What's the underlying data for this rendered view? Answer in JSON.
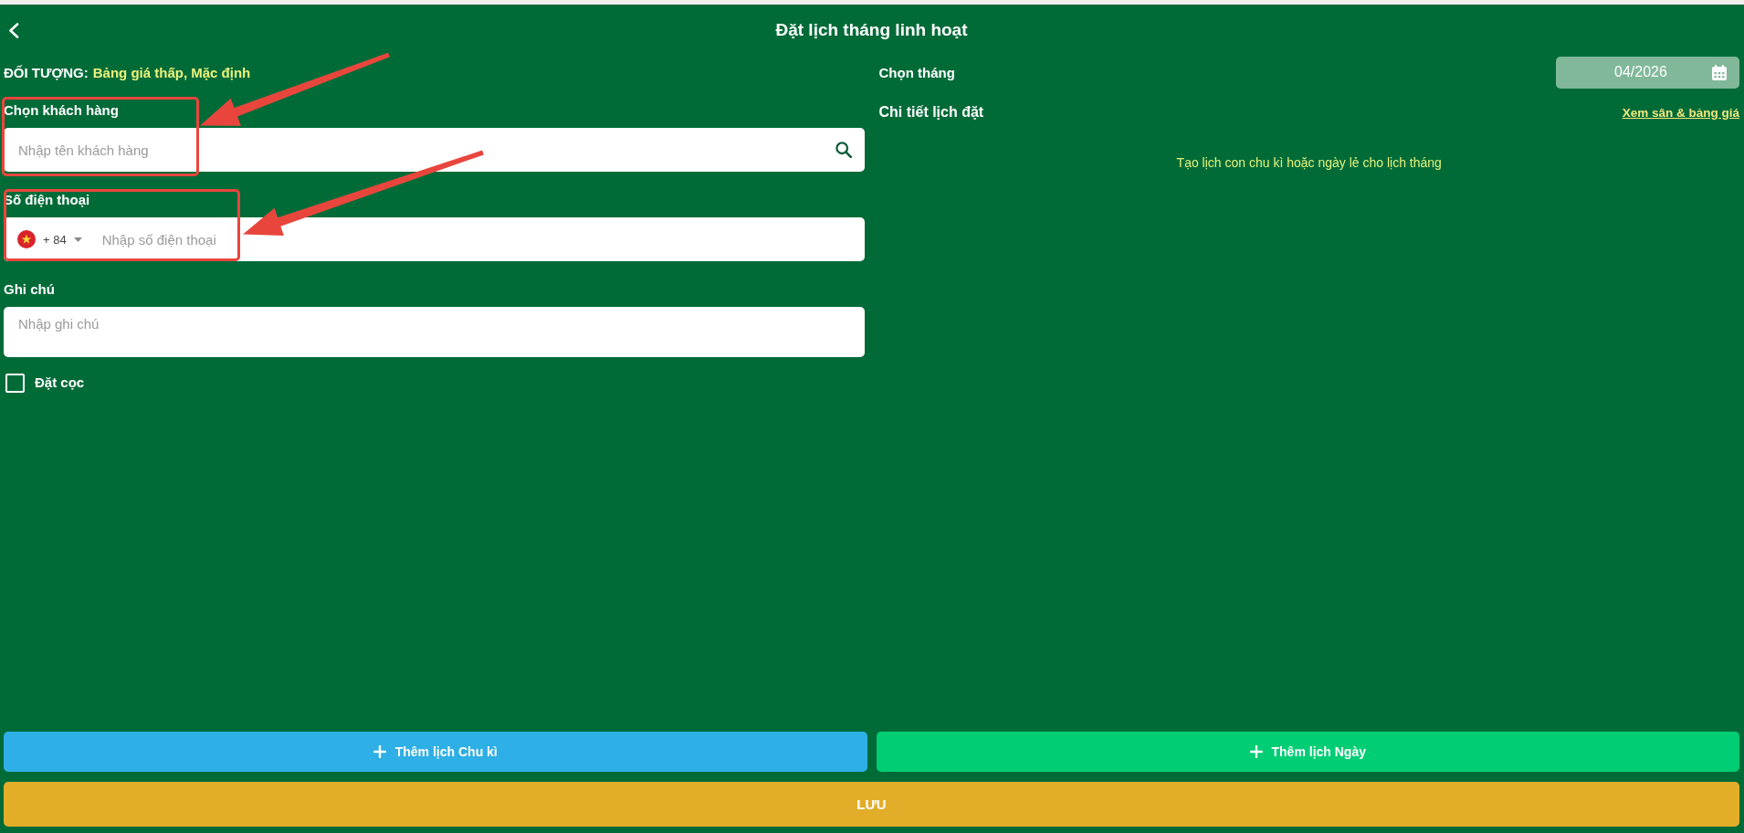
{
  "header": {
    "title": "Đặt lịch tháng linh hoạt"
  },
  "target": {
    "label": "ĐỐI TƯỢNG:",
    "value": "Bảng giá thấp, Mặc định"
  },
  "fields": [
    {
      "kind": "search",
      "label": "Chọn khách hàng",
      "placeholder": "Nhập tên khách hàng"
    },
    {
      "kind": "phone",
      "label": "Số điện thoại",
      "country_code": "+ 84",
      "placeholder": "Nhập số điện thoại"
    },
    {
      "kind": "textarea",
      "label": "Ghi chú",
      "placeholder": "Nhập ghi chú"
    }
  ],
  "deposit": {
    "label": "Đặt cọc",
    "checked": false
  },
  "month": {
    "label": "Chọn tháng",
    "value": "04/2026"
  },
  "schedule": {
    "title": "Chi tiết lịch đặt",
    "link": "Xem sân & bảng giá",
    "empty_message": "Tạo lịch con chu kì hoặc ngày lẻ cho lịch tháng"
  },
  "actions": [
    {
      "kind": "cycle",
      "label": "Thêm lịch Chu kì"
    },
    {
      "kind": "day",
      "label": "Thêm lịch Ngày"
    }
  ],
  "save_button": {
    "label": "LƯU"
  },
  "annotations": [
    {
      "kind": "box"
    },
    {
      "kind": "arrow"
    },
    {
      "kind": "box"
    },
    {
      "kind": "arrow"
    }
  ]
}
